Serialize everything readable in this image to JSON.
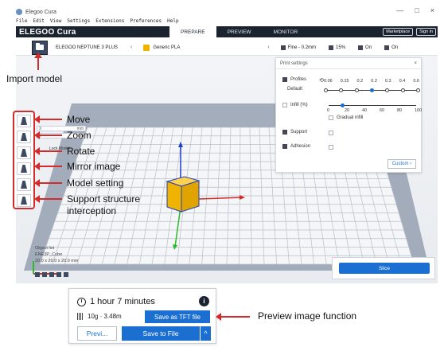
{
  "window": {
    "title": "Elegoo Cura",
    "controls": [
      "—",
      "□",
      "×"
    ]
  },
  "menu": [
    "File",
    "Edit",
    "View",
    "Settings",
    "Extensions",
    "Preferences",
    "Help"
  ],
  "header": {
    "logo": "ELEGOO Cura",
    "stages": [
      "PREPARE",
      "PREVIEW",
      "MONITOR"
    ],
    "active_stage": "PREPARE",
    "buttons": [
      "Marketplace",
      "Sign in"
    ]
  },
  "toolbar": {
    "machine": "ELEGOO NEPTUNE 3 PLUS",
    "material": "Generic PLA",
    "profile": "Fine - 0.2mm",
    "infill": "15%",
    "support": "On",
    "adhesion": "On"
  },
  "move_tool": {
    "x_unit": "mm",
    "lock_label": "Lock Model"
  },
  "annotations": {
    "import": "Import model",
    "move": "Move",
    "zoom": "Zoom",
    "rotate": "Rotate",
    "mirror": "Mirror image",
    "model_setting": "Model setting",
    "support_1": "Support structure",
    "support_2": "interception",
    "preview_fn": "Preview image function"
  },
  "settings": {
    "title": "Print settings",
    "close": "×",
    "profiles_label": "Profiles",
    "default_label": "Default",
    "layer_heights": [
      "0.06",
      "0.15",
      "0.2",
      "0.2",
      "0.3",
      "0.4",
      "0.6"
    ],
    "selected_layer_index": 3,
    "infill_label": "Infill (%)",
    "infill_ticks": [
      "0",
      "20",
      "40",
      "60",
      "80",
      "100"
    ],
    "infill_value": 15,
    "gradual_infill": "Gradual infill",
    "support_label": "Support",
    "adhesion_label": "Adhesion",
    "custom_button": "Custom"
  },
  "object_list": {
    "header": "Object list",
    "file": "ENE3P_Cube",
    "dims": "20.0 x 20.0 x 20.0 mm"
  },
  "slice": {
    "button": "Slice"
  },
  "preview_panel": {
    "time": "1 hour 7 minutes",
    "material": "10g · 3.48m",
    "tft_button": "Save as TFT file",
    "preview_button": "Previ...",
    "save_button": "Save to File",
    "save_chevron": "^",
    "info": "i"
  },
  "colors": {
    "accent": "#1a6fd1",
    "header": "#1c2330",
    "annotation": "#d42a2a",
    "model": "#f0b400"
  }
}
